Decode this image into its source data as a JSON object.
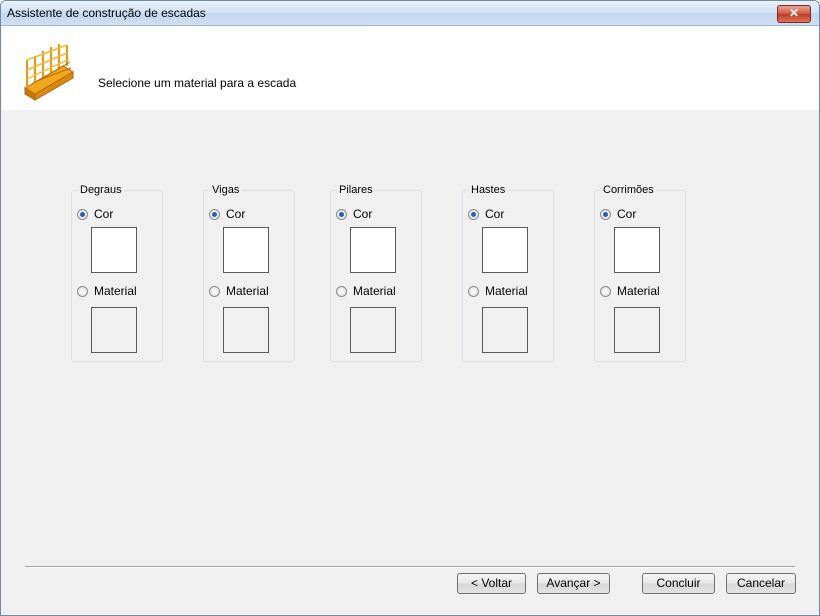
{
  "window": {
    "title": "Assistente de construção de escadas",
    "close_glyph": "✕"
  },
  "header": {
    "icon": "stair-icon",
    "instruction": "Selecione um material para a escada"
  },
  "groups": [
    {
      "title": "Degraus",
      "color_label": "Cor",
      "material_label": "Material",
      "selected": "color",
      "color_value": "#ffffff"
    },
    {
      "title": "Vigas",
      "color_label": "Cor",
      "material_label": "Material",
      "selected": "color",
      "color_value": "#ffffff"
    },
    {
      "title": "Pilares",
      "color_label": "Cor",
      "material_label": "Material",
      "selected": "color",
      "color_value": "#ffffff"
    },
    {
      "title": "Hastes",
      "color_label": "Cor",
      "material_label": "Material",
      "selected": "color",
      "color_value": "#ffffff"
    },
    {
      "title": "Corrimões",
      "color_label": "Cor",
      "material_label": "Material",
      "selected": "color",
      "color_value": "#ffffff"
    }
  ],
  "buttons": {
    "back": "< Voltar",
    "next": "Avançar >",
    "finish": "Concluir",
    "cancel": "Cancelar"
  }
}
